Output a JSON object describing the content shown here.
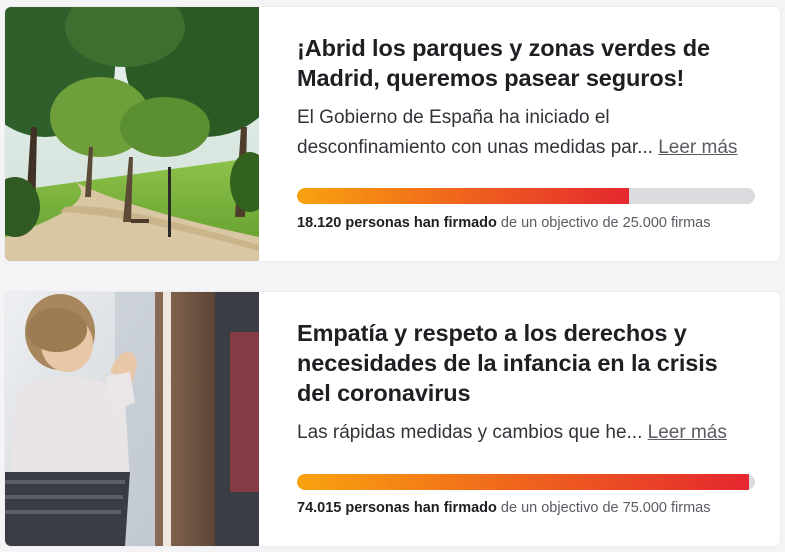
{
  "petitions": [
    {
      "title": "¡Abrid los parques y zonas verdes de Madrid, queremos pasear seguros!",
      "description": "El Gobierno de España ha iniciado el desconfinamiento con unas medidas par...",
      "read_more": "Leer más",
      "signed_count": "18.120",
      "signed_text": "personas han firmado",
      "goal_text": "de un objectivo de 25.000 firmas",
      "progress": 0.7248,
      "image": "park-photo"
    },
    {
      "title": "Empatía y respeto a los derechos y necesidades de la infancia en la crisis del coronavirus",
      "description": "Las rápidas medidas y cambios que he...",
      "read_more": "Leer más",
      "signed_count": "74.015",
      "signed_text": "personas han firmado",
      "goal_text": "de un objectivo de 75.000 firmas",
      "progress": 0.9869,
      "image": "child-at-window-photo"
    }
  ],
  "colors": {
    "progress_start": "#f9a20f",
    "progress_end": "#e5272f",
    "progress_track": "#dcdbe0"
  }
}
